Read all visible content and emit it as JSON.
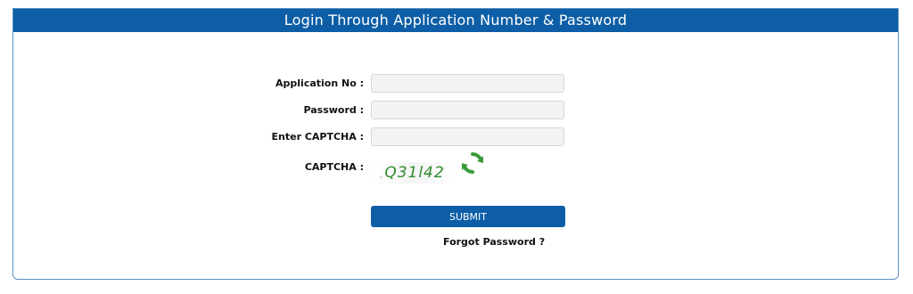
{
  "header": {
    "title": "Login Through Application Number & Password"
  },
  "form": {
    "application_no": {
      "label": "Application No :",
      "value": "",
      "placeholder": ""
    },
    "password": {
      "label": "Password :",
      "value": "",
      "placeholder": ""
    },
    "captcha_input": {
      "label": "Enter CAPTCHA :",
      "value": "",
      "placeholder": ""
    },
    "captcha": {
      "label": "CAPTCHA :",
      "text": "Q31l42",
      "refresh_icon": "refresh-icon",
      "icon_color": "#3a9a3a"
    },
    "submit_label": "SUBMIT",
    "forgot_label": "Forgot Password ?"
  },
  "colors": {
    "brand": "#0d5ea6",
    "border": "#5b8fbf"
  }
}
